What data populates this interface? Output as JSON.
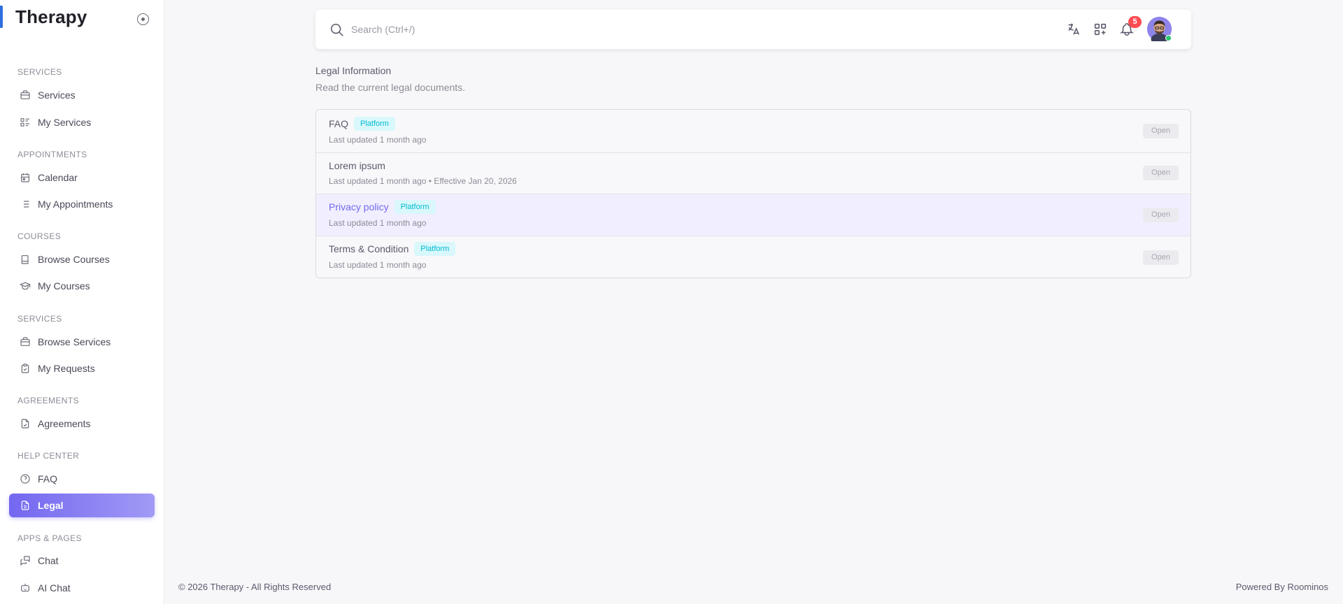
{
  "app": {
    "title": "Therapy"
  },
  "sidebar": {
    "sections": [
      {
        "header": "SERVICES",
        "items": [
          {
            "label": "Services",
            "icon": "briefcase-icon"
          },
          {
            "label": "My Services",
            "icon": "list-details-icon"
          }
        ]
      },
      {
        "header": "APPOINTMENTS",
        "items": [
          {
            "label": "Calendar",
            "icon": "calendar-icon"
          },
          {
            "label": "My Appointments",
            "icon": "list-icon"
          }
        ]
      },
      {
        "header": "COURSES",
        "items": [
          {
            "label": "Browse Courses",
            "icon": "book-icon"
          },
          {
            "label": "My Courses",
            "icon": "school-cap-icon"
          }
        ]
      },
      {
        "header": "SERVICES",
        "items": [
          {
            "label": "Browse Services",
            "icon": "briefcase-icon"
          },
          {
            "label": "My Requests",
            "icon": "clipboard-check-icon"
          }
        ]
      },
      {
        "header": "AGREEMENTS",
        "items": [
          {
            "label": "Agreements",
            "icon": "file-check-icon"
          }
        ]
      },
      {
        "header": "HELP CENTER",
        "items": [
          {
            "label": "FAQ",
            "icon": "help-circle-icon"
          },
          {
            "label": "Legal",
            "icon": "file-text-icon",
            "active": true
          }
        ]
      },
      {
        "header": "APPS & PAGES",
        "items": [
          {
            "label": "Chat",
            "icon": "messages-icon"
          },
          {
            "label": "AI Chat",
            "icon": "robot-icon"
          }
        ]
      }
    ]
  },
  "topbar": {
    "search_placeholder": "Search (Ctrl+/)",
    "notification_count": "5",
    "icons": [
      "language-icon",
      "grid-plus-icon",
      "bell-icon"
    ]
  },
  "page": {
    "title": "Legal Information",
    "subtitle": "Read the current legal documents."
  },
  "documents": [
    {
      "title": "FAQ",
      "badge": "Platform",
      "meta": "Last updated 1 month ago",
      "action": "Open"
    },
    {
      "title": "Lorem ipsum",
      "badge": "",
      "meta": "Last updated 1 month ago • Effective Jan 20, 2026",
      "action": "Open"
    },
    {
      "title": "Privacy policy",
      "badge": "Platform",
      "meta": "Last updated 1 month ago",
      "action": "Open"
    },
    {
      "title": "Terms & Condition",
      "badge": "Platform",
      "meta": "Last updated 1 month ago",
      "action": "Open"
    }
  ],
  "footer": {
    "left": "© 2026 Therapy - All Rights Reserved",
    "right": "Powered By Roominos"
  },
  "colors": {
    "accent": "#7367f0",
    "badge_text": "#00bad1",
    "badge_bg": "#d9f8fc",
    "notification": "#ff4c51",
    "online": "#28c76f"
  }
}
